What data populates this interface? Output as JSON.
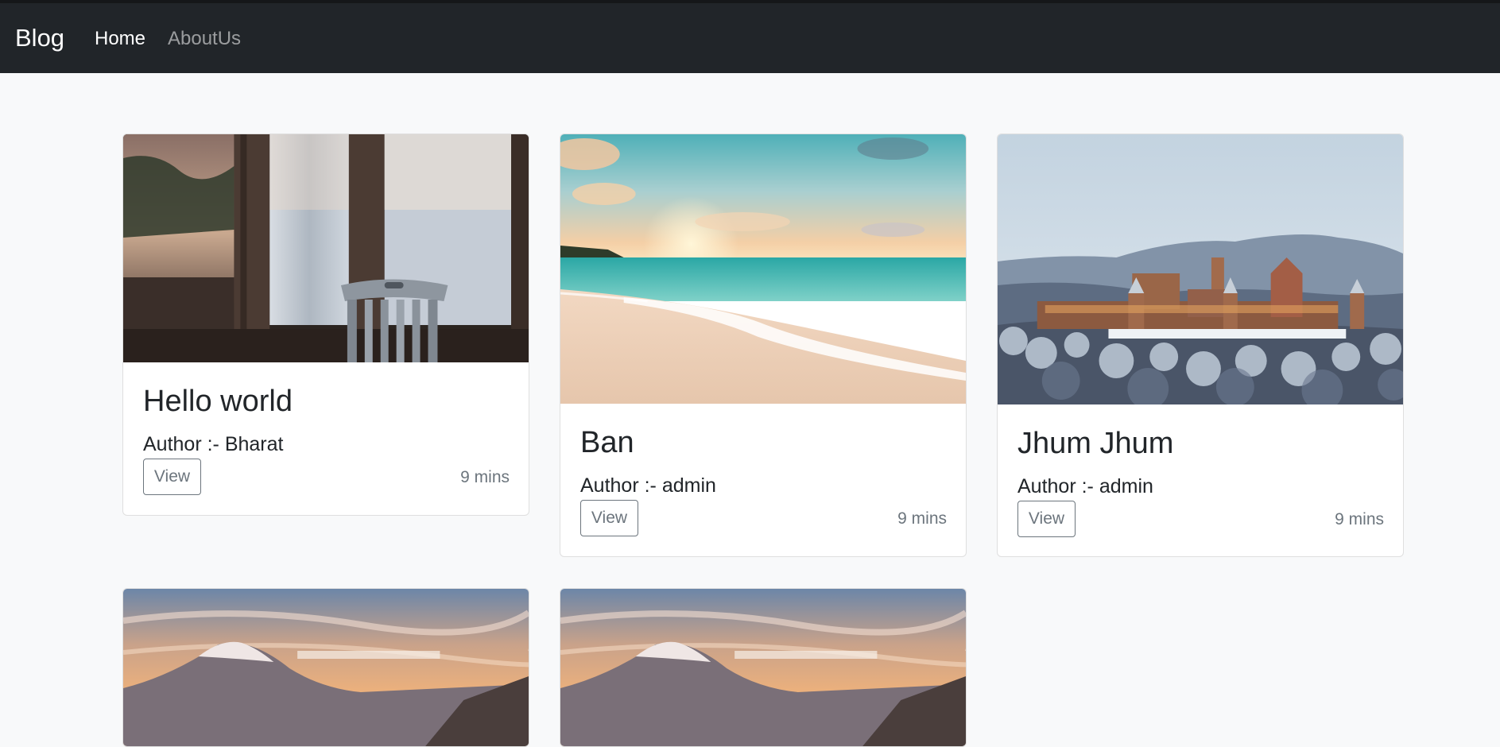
{
  "navbar": {
    "brand": "Blog",
    "links": [
      {
        "label": "Home",
        "active": true
      },
      {
        "label": "AboutUs",
        "active": false
      }
    ]
  },
  "posts": [
    {
      "title": "Hello world",
      "author": "Author :- Bharat",
      "view_label": "View",
      "read_time": "9 mins",
      "image": "window-chair-photo"
    },
    {
      "title": "Ban",
      "author": "Author :- admin",
      "view_label": "View",
      "read_time": "9 mins",
      "image": "beach-sunset-photo"
    },
    {
      "title": "Jhum Jhum",
      "author": "Author :- admin",
      "view_label": "View",
      "read_time": "9 mins",
      "image": "snowy-castle-photo"
    },
    {
      "title": "",
      "author": "",
      "view_label": "",
      "read_time": "",
      "image": "mountain-sunset-photo"
    },
    {
      "title": "",
      "author": "",
      "view_label": "",
      "read_time": "",
      "image": "mountain-sunset-photo"
    }
  ],
  "colors": {
    "navbar_bg": "#212529",
    "page_bg": "#f8f9fa",
    "button_border": "#6c757d",
    "muted_text": "#6c757d"
  }
}
